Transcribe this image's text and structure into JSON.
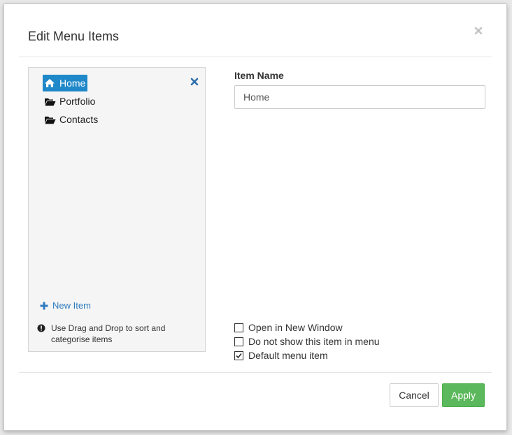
{
  "dialog": {
    "title": "Edit Menu Items",
    "close_icon": "close-icon"
  },
  "menu_tree": {
    "items": [
      {
        "label": "Home",
        "icon": "home-icon",
        "selected": true
      },
      {
        "label": "Portfolio",
        "icon": "folder-open-icon",
        "selected": false
      },
      {
        "label": "Contacts",
        "icon": "folder-open-icon",
        "selected": false
      }
    ],
    "remove_icon": "remove-icon",
    "new_item_label": "New Item",
    "hint_text": "Use Drag and Drop to sort and categorise items"
  },
  "item_form": {
    "item_name_label": "Item Name",
    "item_name_value": "Home",
    "options": [
      {
        "label": "Open in New Window",
        "checked": false
      },
      {
        "label": "Do not show this item in menu",
        "checked": false
      },
      {
        "label": "Default menu item",
        "checked": true
      }
    ]
  },
  "footer": {
    "cancel_label": "Cancel",
    "apply_label": "Apply"
  },
  "colors": {
    "selected_bg": "#1f88c9",
    "link": "#2f7bbf",
    "apply_bg": "#5cb85c"
  }
}
